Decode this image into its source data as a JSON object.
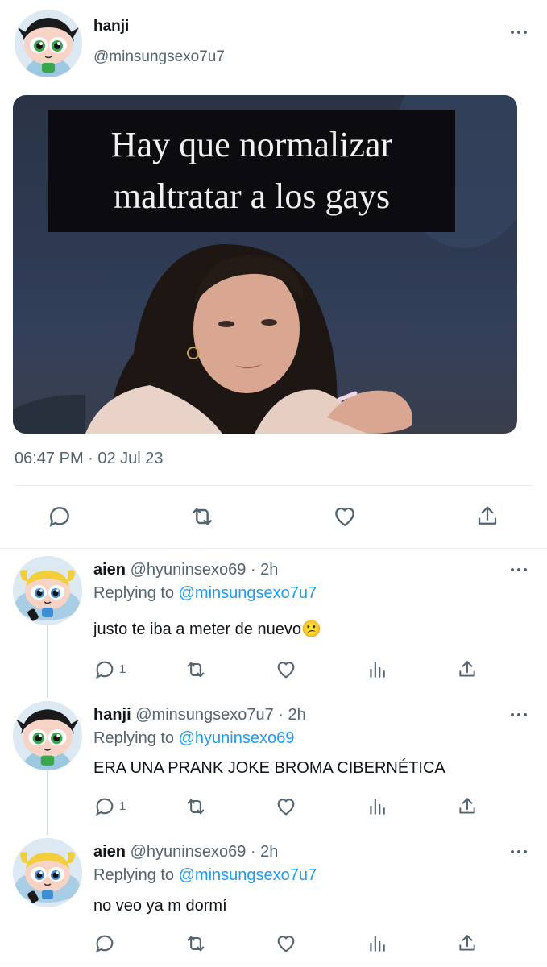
{
  "main_tweet": {
    "display_name": "hanji",
    "handle": "@minsungsexo7u7",
    "image_caption_lines": [
      "Hay que normalizar",
      "maltratar a los gays"
    ],
    "timestamp": "06:47 PM · 02 Jul 23"
  },
  "replies": [
    {
      "display_name": "aien",
      "handle_time": "@hyuninsexo69 · 2h",
      "replying_prefix": "Replying to",
      "replying_to": "@minsungsexo7u7",
      "text": "justo te iba a meter de nuevo😕",
      "reply_count": "1",
      "avatar_icon": "bubbles-avatar-icon"
    },
    {
      "display_name": "hanji",
      "handle_time": "@minsungsexo7u7 · 2h",
      "replying_prefix": "Replying to",
      "replying_to": "@hyuninsexo69",
      "text": "ERA UNA PRANK JOKE BROMA CIBERNÉTICA",
      "reply_count": "1",
      "avatar_icon": "buttercup-avatar-icon"
    },
    {
      "display_name": "aien",
      "handle_time": "@hyuninsexo69 · 2h",
      "replying_prefix": "Replying to",
      "replying_to": "@minsungsexo7u7",
      "text": "no veo ya m dormí",
      "reply_count": "",
      "avatar_icon": "bubbles-avatar-icon"
    }
  ],
  "colors": {
    "accent": "#1d9bf0",
    "muted": "#536471",
    "divider": "#e6ecf0"
  }
}
